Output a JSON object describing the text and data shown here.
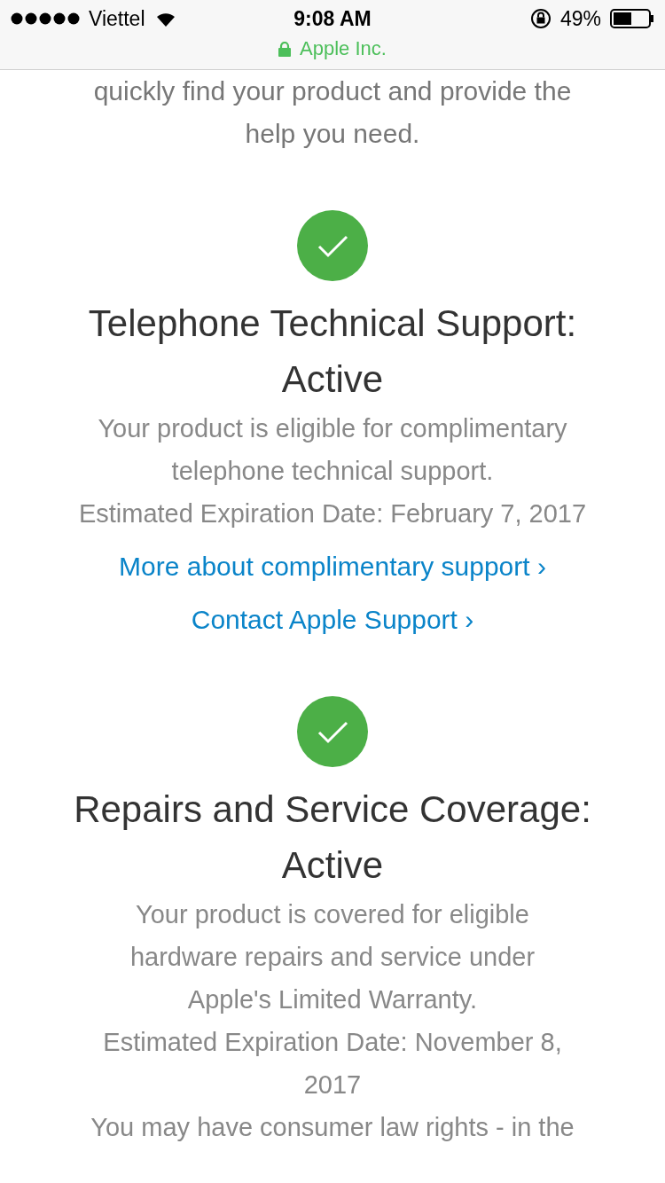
{
  "status_bar": {
    "carrier": "Viettel",
    "time": "9:08 AM",
    "battery": "49%",
    "site": "Apple Inc."
  },
  "intro": "quickly find your product and provide the help you need.",
  "sections": [
    {
      "title": "Telephone Technical Support: Active",
      "active": true,
      "paragraphs": [
        "Your product is eligible for complimentary telephone technical support.",
        "Estimated Expiration Date: February 7, 2017"
      ],
      "links": [
        "More about complimentary support ›",
        "Contact Apple Support ›"
      ]
    },
    {
      "title": "Repairs and Service Coverage: Active",
      "active": true,
      "paragraphs": [
        "Your product is covered for eligible hardware repairs and service under Apple's Limited Warranty.",
        "Estimated Expiration Date: November 8, 2017",
        "You may have consumer law rights - in the"
      ]
    }
  ]
}
